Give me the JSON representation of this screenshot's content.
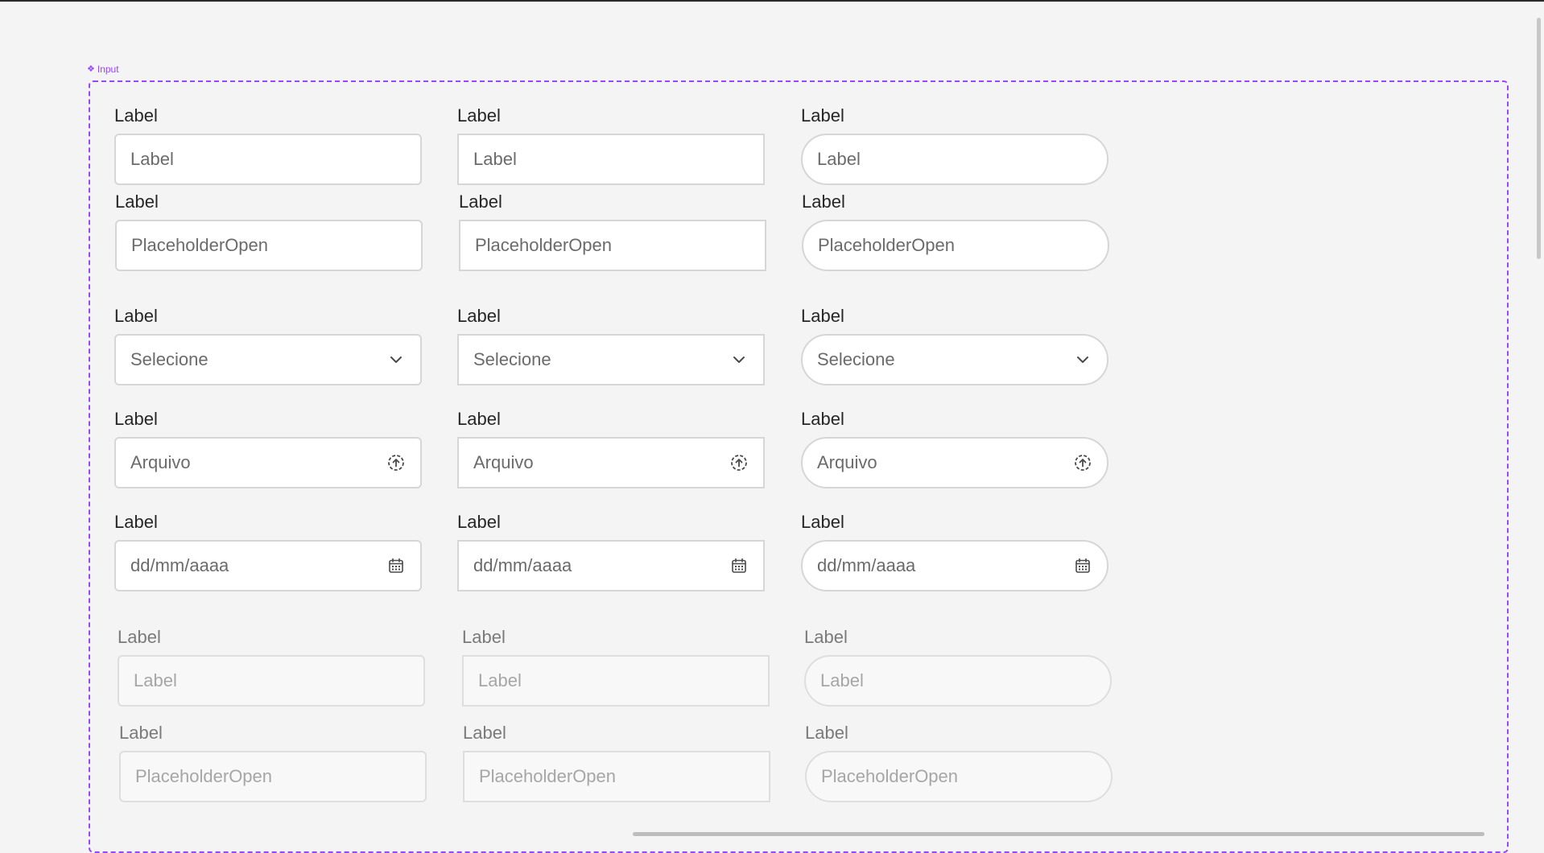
{
  "frame": {
    "name": "Input",
    "accent": "#9747ff"
  },
  "rows": [
    {
      "label": "Label",
      "value": "Label",
      "icon": null
    },
    {
      "label": "Label",
      "value": "PlaceholderOpen",
      "icon": null
    },
    {
      "label": "Label",
      "value": "Selecione",
      "icon": "chevron-down-icon"
    },
    {
      "label": "Label",
      "value": "Arquivo",
      "icon": "upload-icon"
    },
    {
      "label": "Label",
      "value": "dd/mm/aaaa",
      "icon": "calendar-icon"
    },
    {
      "label": "Label",
      "value": "Label",
      "icon": null,
      "disabled": true
    },
    {
      "label": "Label",
      "value": "PlaceholderOpen",
      "icon": null,
      "disabled": true
    }
  ],
  "variants": [
    "rounded-small",
    "square",
    "pill"
  ]
}
